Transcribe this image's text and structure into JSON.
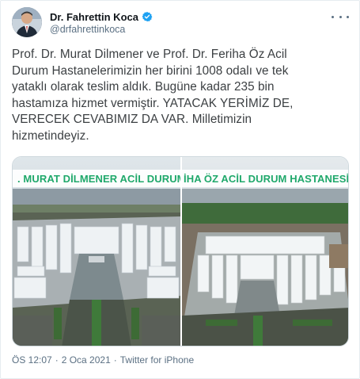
{
  "author": {
    "name": "Dr. Fahrettin Koca",
    "handle": "@drfahrettinkoca",
    "verified": true
  },
  "tweet": {
    "lines": [
      "Prof. Dr. Murat Dilmener ve Prof. Dr. Feriha Öz Acil",
      "Durum Hastanelerimizin her birini 1008 odalı ve tek",
      "yataklı olarak teslim aldık. Bugüne kadar 235 bin",
      "hastamıza hizmet vermiştir. YATACAK YERİMİZ DE,",
      "VERECEK CEVABIMIZ DA VAR. Milletimizin",
      "hizmetindeyiz."
    ]
  },
  "media": {
    "photo_left": {
      "banner": ". MURAT DİLMENER ACİL DURUM HASTANESİ"
    },
    "photo_right": {
      "banner": "İHA ÖZ ACİL DURUM HASTANESİ"
    }
  },
  "meta": {
    "time": "ÖS 12:07",
    "separator": "·",
    "date": "2 Oca 2021",
    "source": "Twitter for iPhone"
  },
  "colors": {
    "verified": "#1da1f2",
    "banner_text": "#1fa86b",
    "muted": "#5b7083"
  },
  "icons": {
    "verified": "verified-badge-icon",
    "more": "more-options-icon"
  }
}
